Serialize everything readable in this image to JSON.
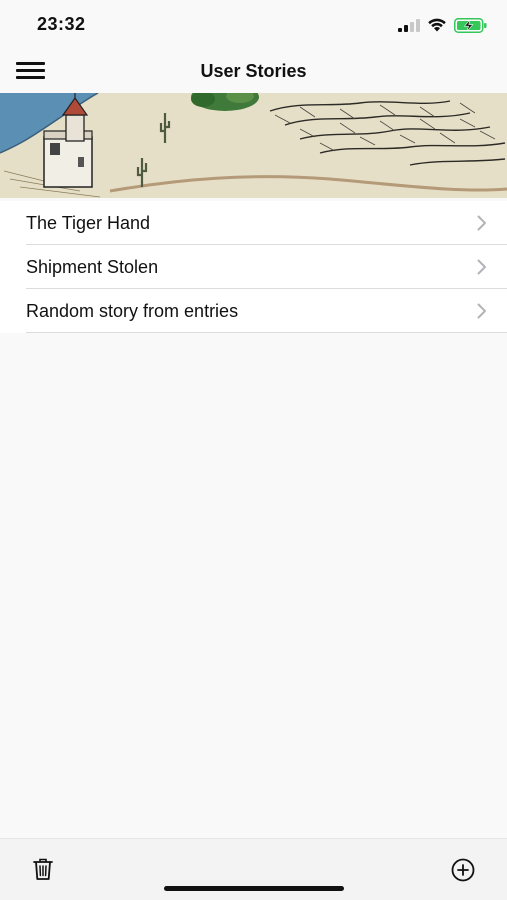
{
  "status": {
    "time": "23:32",
    "icons": [
      "cellular-signal-icon",
      "wifi-icon",
      "battery-charging-icon"
    ],
    "battery_color": "#35c759"
  },
  "nav": {
    "title": "User Stories",
    "menu_icon": "hamburger-menu-icon"
  },
  "banner": {
    "description_icon": "fantasy-map-banner",
    "colors": {
      "sand": "#e6dfc8",
      "water": "#5b8fb4",
      "grass": "#3f7a3a"
    }
  },
  "stories": [
    {
      "label": "The Tiger Hand"
    },
    {
      "label": "Shipment Stolen"
    },
    {
      "label": "Random story from entries"
    }
  ],
  "toolbar": {
    "delete_icon": "trash-icon",
    "add_icon": "plus-circle-icon"
  }
}
